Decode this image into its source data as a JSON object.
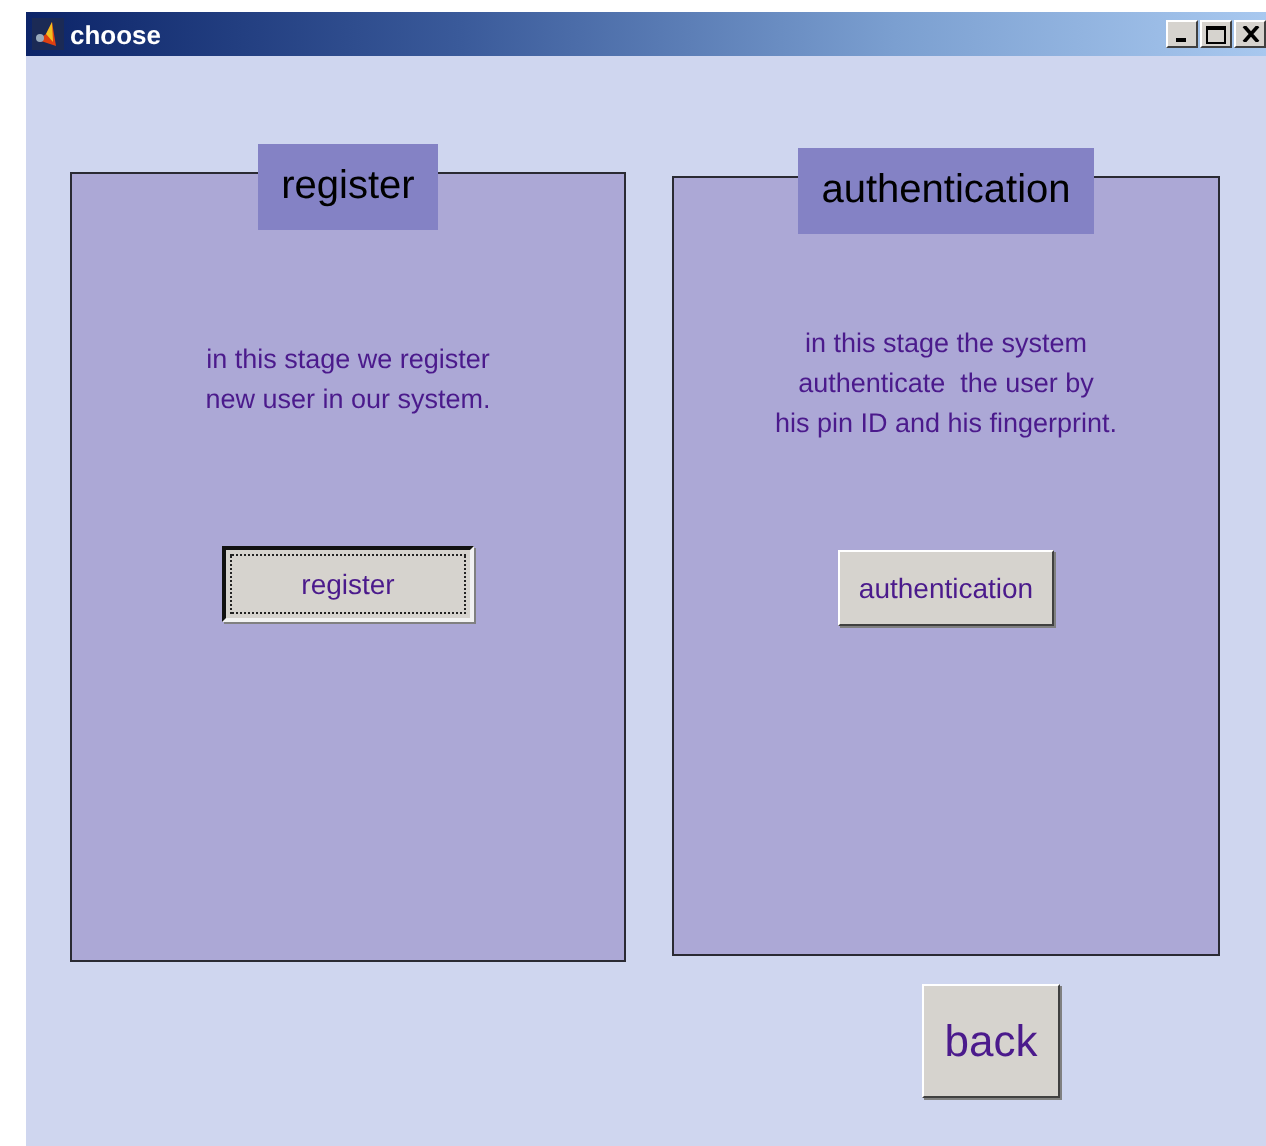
{
  "window": {
    "title": "choose"
  },
  "panels": [
    {
      "title": "register",
      "description": "in this stage we register\nnew user in our system.",
      "button": {
        "label": "register",
        "focused": true
      }
    },
    {
      "title": "authentication",
      "description": "in this stage the system\nauthenticate  the user by\nhis pin ID and his fingerprint.",
      "button": {
        "label": "authentication",
        "focused": false
      }
    }
  ],
  "back_button": {
    "label": "back",
    "focused": false
  }
}
